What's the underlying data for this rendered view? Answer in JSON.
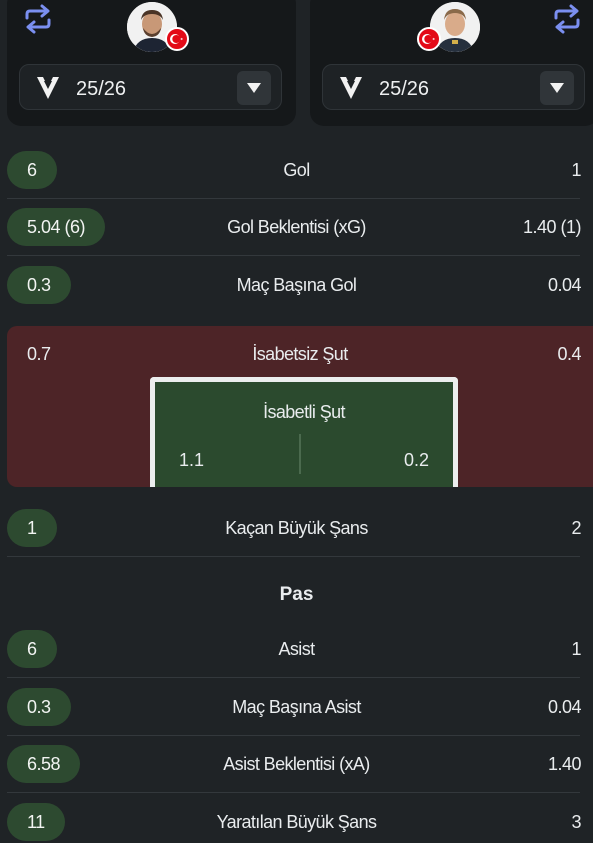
{
  "players": [
    {
      "side": "left",
      "season": "25/26"
    },
    {
      "side": "right",
      "season": "25/26"
    }
  ],
  "colors": {
    "accent": "#7b8ff0",
    "pill": "#2d4a30",
    "shot_box": "#4d2427",
    "goal_bg": "#2b4a2e"
  },
  "stats_top": [
    {
      "left": "6",
      "label": "Gol",
      "right": "1"
    },
    {
      "left": "5.04 (6)",
      "label": "Gol Beklentisi (xG)",
      "right": "1.40 (1)"
    },
    {
      "left": "0.3",
      "label": "Maç Başına Gol",
      "right": "0.04"
    }
  ],
  "shots": {
    "off_target": {
      "left": "0.7",
      "label": "İsabetsiz Şut",
      "right": "0.4"
    },
    "on_target": {
      "left": "1.1",
      "label": "İsabetli Şut",
      "right": "0.2"
    }
  },
  "big_chance_missed": {
    "left": "1",
    "label": "Kaçan Büyük Şans",
    "right": "2"
  },
  "section_pass": "Pas",
  "stats_pass": [
    {
      "left": "6",
      "label": "Asist",
      "right": "1"
    },
    {
      "left": "0.3",
      "label": "Maç Başına Asist",
      "right": "0.04"
    },
    {
      "left": "6.58",
      "label": "Asist Beklentisi (xA)",
      "right": "1.40"
    },
    {
      "left": "11",
      "label": "Yaratılan Büyük Şans",
      "right": "3"
    }
  ]
}
